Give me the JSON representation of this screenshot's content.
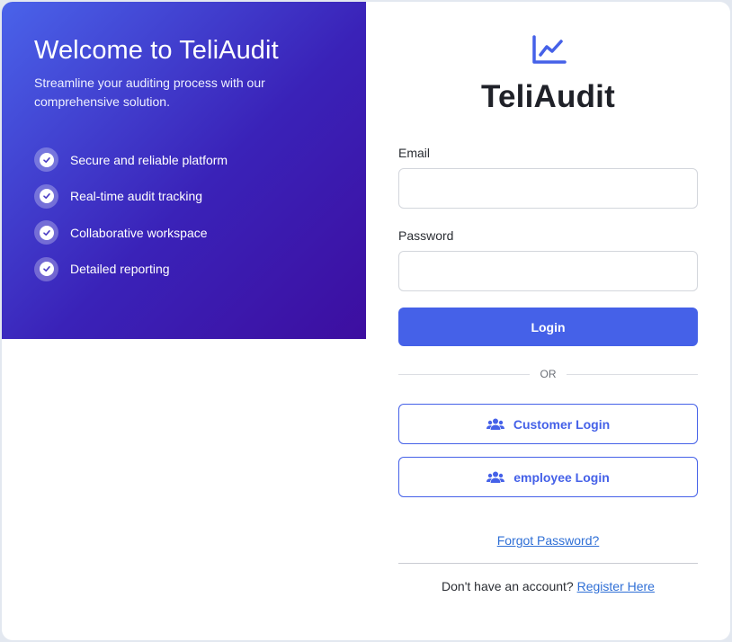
{
  "hero": {
    "title": "Welcome to TeliAudit",
    "subtitle": "Streamline your auditing process with our comprehensive solution.",
    "features": [
      {
        "label": "Secure and reliable platform",
        "icon": "check-circle-icon"
      },
      {
        "label": "Real-time audit tracking",
        "icon": "check-circle-icon"
      },
      {
        "label": "Collaborative workspace",
        "icon": "check-circle-icon"
      },
      {
        "label": "Detailed reporting",
        "icon": "check-circle-icon"
      }
    ]
  },
  "login": {
    "logo_icon": "chart-line-icon",
    "brand": "TeliAudit",
    "email_label": "Email",
    "email_value": "",
    "password_label": "Password",
    "password_value": "",
    "login_button": "Login",
    "divider_text": "OR",
    "customer_login": "Customer Login",
    "employee_login": "employee Login",
    "users_icon": "users-icon",
    "forgot_password": "Forgot Password?",
    "no_account_text": "Don't have an account?",
    "register_link": "Register Here"
  },
  "colors": {
    "accent": "#4561e8",
    "hero_gradient_start": "#4a63ea",
    "hero_gradient_end": "#3d0ea0",
    "link": "#2f6fd6",
    "text_dark": "#1f2128"
  }
}
